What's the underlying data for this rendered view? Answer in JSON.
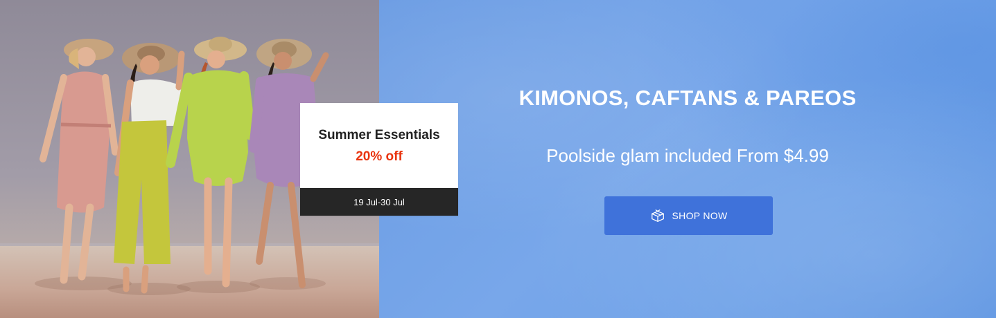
{
  "promo": {
    "headline": "KIMONOS, CAFTANS & PAREOS",
    "subline": "Poolside glam included From $4.99",
    "cta_label": "SHOP NOW",
    "cta_icon": "gift-box-icon"
  },
  "sale_card": {
    "title": "Summer Essentials",
    "discount": "20% off",
    "dates": "19 Jul-30 Jul"
  },
  "colors": {
    "promo_background": "#72a2e8",
    "cta_background": "#3f72da",
    "discount_text": "#e9340f",
    "card_footer": "#262626"
  }
}
